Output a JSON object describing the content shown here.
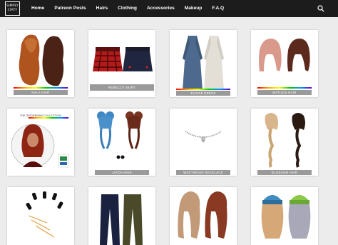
{
  "logo": {
    "line1": "SIMPLY",
    "line2": "CIATY"
  },
  "nav": {
    "items": [
      "Home",
      "Patreon Posts",
      "Hairs",
      "Clothing",
      "Accessories",
      "Makeup",
      "F.A.Q"
    ]
  },
  "cards": [
    {
      "label": "NALA HAIR"
    },
    {
      "label": "REBECCA SKIRT"
    },
    {
      "label": "ELOISE DRESS"
    },
    {
      "label": "MATILDA HAIR"
    },
    {
      "label": "THE SPIDERMAN COLLECTION"
    },
    {
      "label": "JAYDA HAIR"
    },
    {
      "label": "WESTWOOD NECKLACE"
    },
    {
      "label": "BLOSSOM HAIR"
    }
  ],
  "colors": {
    "navbar": "#1c1c1c",
    "page_bg": "#ececec",
    "label_bg": "#9a9a9a"
  }
}
